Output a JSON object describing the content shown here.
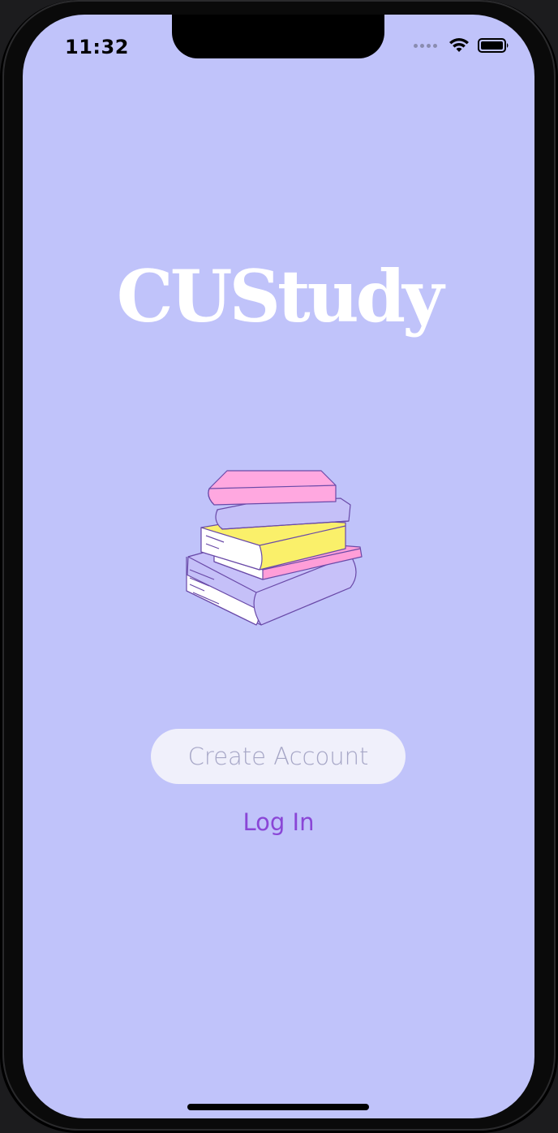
{
  "status_bar": {
    "time": "11:32",
    "icons": [
      "cellular-signal-icon",
      "wifi-icon",
      "battery-icon"
    ]
  },
  "app": {
    "title": "CUStudy",
    "illustration": "stack-of-books-illustration"
  },
  "actions": {
    "create_account_label": "Create Account",
    "log_in_label": "Log In"
  },
  "colors": {
    "background": "#c0c3fa",
    "title": "#ffffff",
    "create_button_bg": "#f0f0fb",
    "create_button_text": "#a6a6c6",
    "log_in_text": "#8a46d6"
  }
}
